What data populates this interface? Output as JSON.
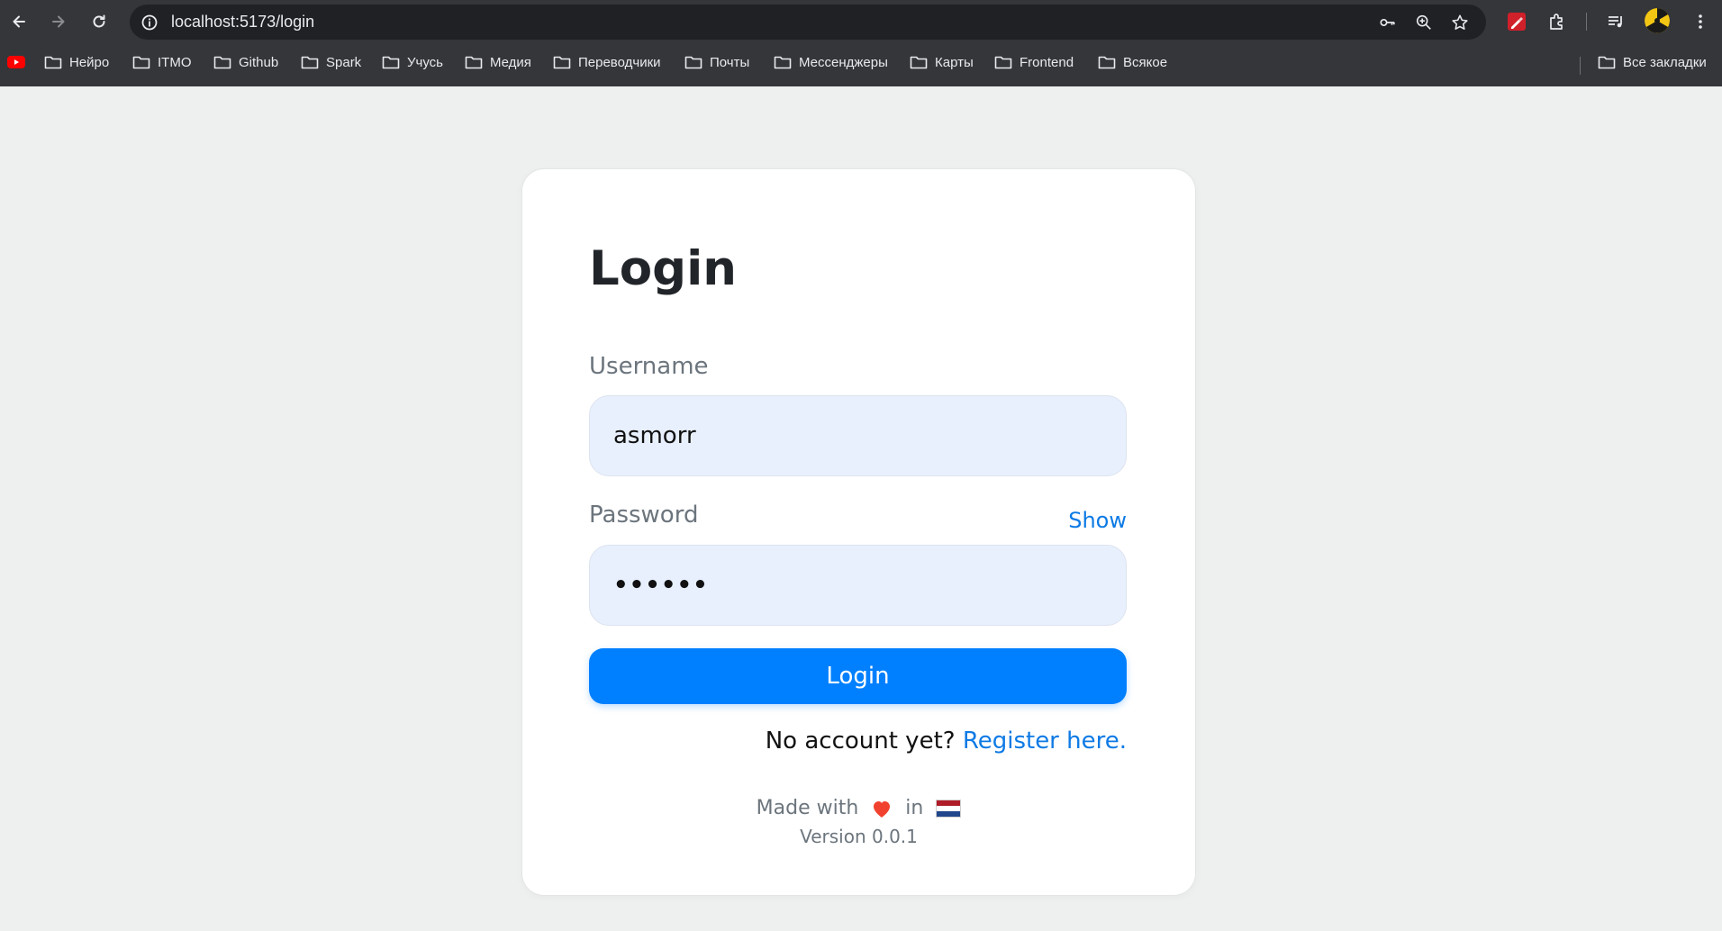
{
  "browser": {
    "url": "localhost:5173/login",
    "bookmarks": [
      "Нейро",
      "ITMO",
      "Github",
      "Spark",
      "Учусь",
      "Медия",
      "Переводчики",
      "Почты",
      "Мессенджеры",
      "Карты",
      "Frontend",
      "Всякое"
    ],
    "all_bookmarks": "Все закладки"
  },
  "login": {
    "title": "Login",
    "username_label": "Username",
    "username_value": "asmorr",
    "password_label": "Password",
    "password_value": "••••••",
    "show_label": "Show",
    "submit_label": "Login",
    "no_account": "No account yet?",
    "register_link": "Register here.",
    "made_with": "Made with",
    "in": "in",
    "version": "Version 0.0.1"
  },
  "colors": {
    "accent": "#0080ff",
    "link": "#0d7ae5",
    "input_bg": "#e8f0fe",
    "page_bg": "#eef0ef"
  }
}
